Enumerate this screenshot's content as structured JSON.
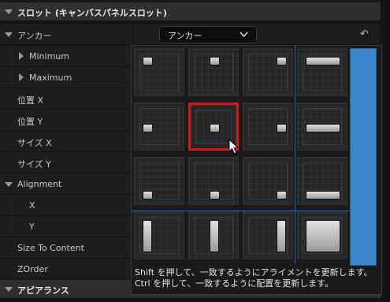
{
  "sections": {
    "slot_title": "スロット (キャンバスパネルスロット)",
    "appearance_title": "アピアランス"
  },
  "props": {
    "anchors": "アンカー",
    "minimum": "Minimum",
    "maximum": "Maximum",
    "pos_x": "位置 X",
    "pos_y": "位置 Y",
    "size_x": "サイズ X",
    "size_y": "サイズ Y",
    "alignment": "Alignment",
    "align_x": "X",
    "align_y": "Y",
    "size_to_content": "Size To Content",
    "zorder": "ZOrder"
  },
  "anchor_dropdown": {
    "label": "アンカー",
    "chevron": "⌄"
  },
  "reset_icon_glyph": "↶",
  "popup": {
    "tooltip_line1": "Shift を押して、一致するようにアライメントを更新します。",
    "tooltip_line2": "Ctrl を押して、一致するように配置を更新します。",
    "selected_preset": "center"
  },
  "colors": {
    "selection": "#d8161b",
    "accent_blue": "#3d86cc",
    "divider_blue": "#1a6fb8"
  }
}
